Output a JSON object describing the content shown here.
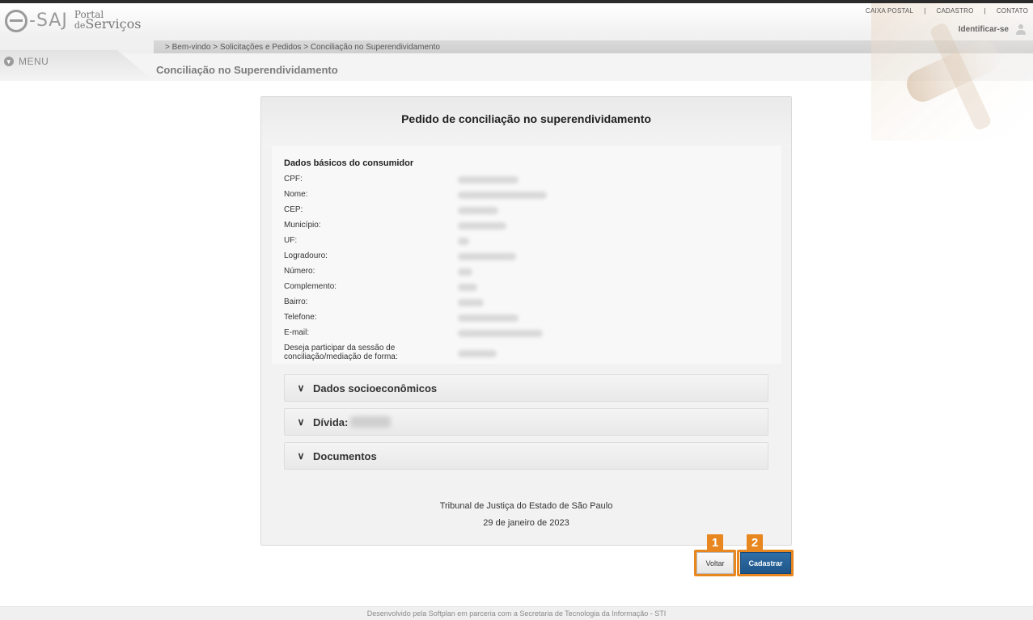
{
  "header": {
    "logo_portal_line1": "Portal",
    "logo_portal_de": "de",
    "logo_portal_line2": "Serviços",
    "logo_esaj": "-SAJ",
    "links": [
      "CAIXA POSTAL",
      "CADASTRO",
      "CONTATO"
    ],
    "identify_label": "Identificar-se"
  },
  "menu": {
    "label": "MENU"
  },
  "breadcrumb": {
    "items": [
      "> Bem-vindo",
      "> Solicitações e Pedidos",
      "> Conciliação no Superendividamento"
    ]
  },
  "page_title": "Conciliação no Superendividamento",
  "form": {
    "title": "Pedido de conciliação no superendividamento",
    "section_title": "Dados básicos do consumidor",
    "fields": [
      {
        "label": "CPF:"
      },
      {
        "label": "Nome:"
      },
      {
        "label": "CEP:"
      },
      {
        "label": "Município:"
      },
      {
        "label": "UF:"
      },
      {
        "label": "Logradouro:"
      },
      {
        "label": "Número:"
      },
      {
        "label": "Complemento:"
      },
      {
        "label": "Bairro:"
      },
      {
        "label": "Telefone:"
      },
      {
        "label": "E-mail:"
      },
      {
        "label": "Deseja participar da sessão de conciliação/mediação de forma:"
      }
    ],
    "accordions": [
      {
        "label": "Dados socioeconômicos"
      },
      {
        "label": "Dívida:"
      },
      {
        "label": "Documentos"
      }
    ],
    "footer_org": "Tribunal de Justiça do Estado de São Paulo",
    "footer_date": "29 de janeiro de 2023"
  },
  "actions": {
    "back_label": "Voltar",
    "submit_label": "Cadastrar",
    "callout_1": "1",
    "callout_2": "2",
    "callout_color": "#e8871f",
    "submit_color": "#2f6fa8"
  },
  "site_footer": "Desenvolvido pela Softplan em parceria com a Secretaria de Tecnologia da Informação - STI"
}
